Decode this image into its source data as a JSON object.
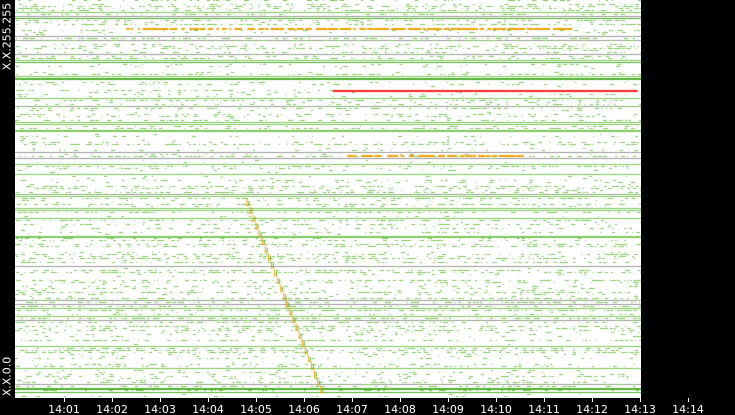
{
  "chart_data": {
    "type": "scatter",
    "title": "",
    "ylabel_top": "X.X.255.255",
    "ylabel_bottom": "X.X.0.0",
    "x_ticks": [
      "14:01",
      "14:02",
      "14:03",
      "14:04",
      "14:05",
      "14:06",
      "14:07",
      "14:08",
      "14:09",
      "14:10",
      "14:11",
      "14:12",
      "14:13",
      "14:14"
    ],
    "x_range_minutes": [
      0,
      13
    ],
    "colors": {
      "normal": "#7dc85a",
      "dark": "#4caf2a",
      "warn": "#f0a000",
      "alert": "#ff2020",
      "background": "#ffffff",
      "frame": "#000000"
    },
    "highlights": [
      {
        "color": "alert",
        "row_fraction": 0.225,
        "from_min": 6.6,
        "to_min": 12.95
      },
      {
        "color": "warn",
        "row_fraction": 0.07,
        "from_min": 2.3,
        "to_min": 11.5
      },
      {
        "color": "warn",
        "row_fraction": 0.39,
        "from_min": 6.9,
        "to_min": 10.6
      }
    ],
    "scan_sweep": {
      "color": "warn",
      "start": {
        "min": 4.8,
        "row_fraction": 0.5
      },
      "end": {
        "min": 6.4,
        "row_fraction": 0.99
      }
    }
  }
}
